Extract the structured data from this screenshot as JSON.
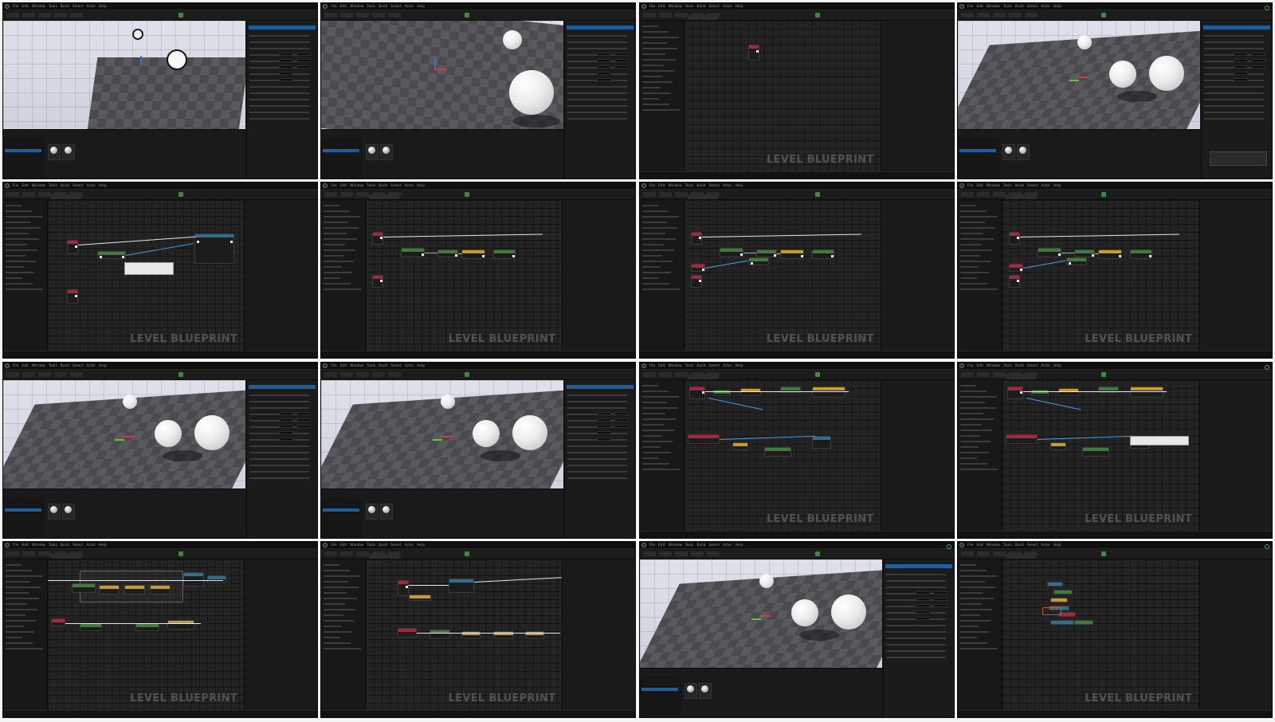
{
  "menu_items": [
    "File",
    "Edit",
    "Window",
    "Tools",
    "Build",
    "Select",
    "Actor",
    "Help"
  ],
  "blueprint_label": "LEVEL BLUEPRINT",
  "tiles": [
    {
      "type": "viewport",
      "variant": "flat-grid-sun"
    },
    {
      "type": "viewport",
      "variant": "floor-sphere"
    },
    {
      "type": "blueprint",
      "variant": "empty-node"
    },
    {
      "type": "viewport",
      "variant": "spheres-far"
    },
    {
      "type": "blueprint",
      "variant": "tooltip"
    },
    {
      "type": "blueprint",
      "variant": "chain"
    },
    {
      "type": "blueprint",
      "variant": "chain-green"
    },
    {
      "type": "blueprint",
      "variant": "chain-blue"
    },
    {
      "type": "viewport",
      "variant": "spheres-gizmo"
    },
    {
      "type": "viewport",
      "variant": "spheres-side"
    },
    {
      "type": "blueprint",
      "variant": "complex"
    },
    {
      "type": "blueprint",
      "variant": "complex-tooltip"
    },
    {
      "type": "blueprint",
      "variant": "comment-box"
    },
    {
      "type": "blueprint",
      "variant": "branching"
    },
    {
      "type": "viewport",
      "variant": "spheres-light"
    },
    {
      "type": "blueprint",
      "variant": "zoomed-out"
    }
  ],
  "colors": {
    "accent": "#1d5e9c",
    "node_red": "#a8263a",
    "node_green": "#3f7b3a",
    "node_blue": "#2d6f8e",
    "node_gold": "#c69a2b"
  }
}
